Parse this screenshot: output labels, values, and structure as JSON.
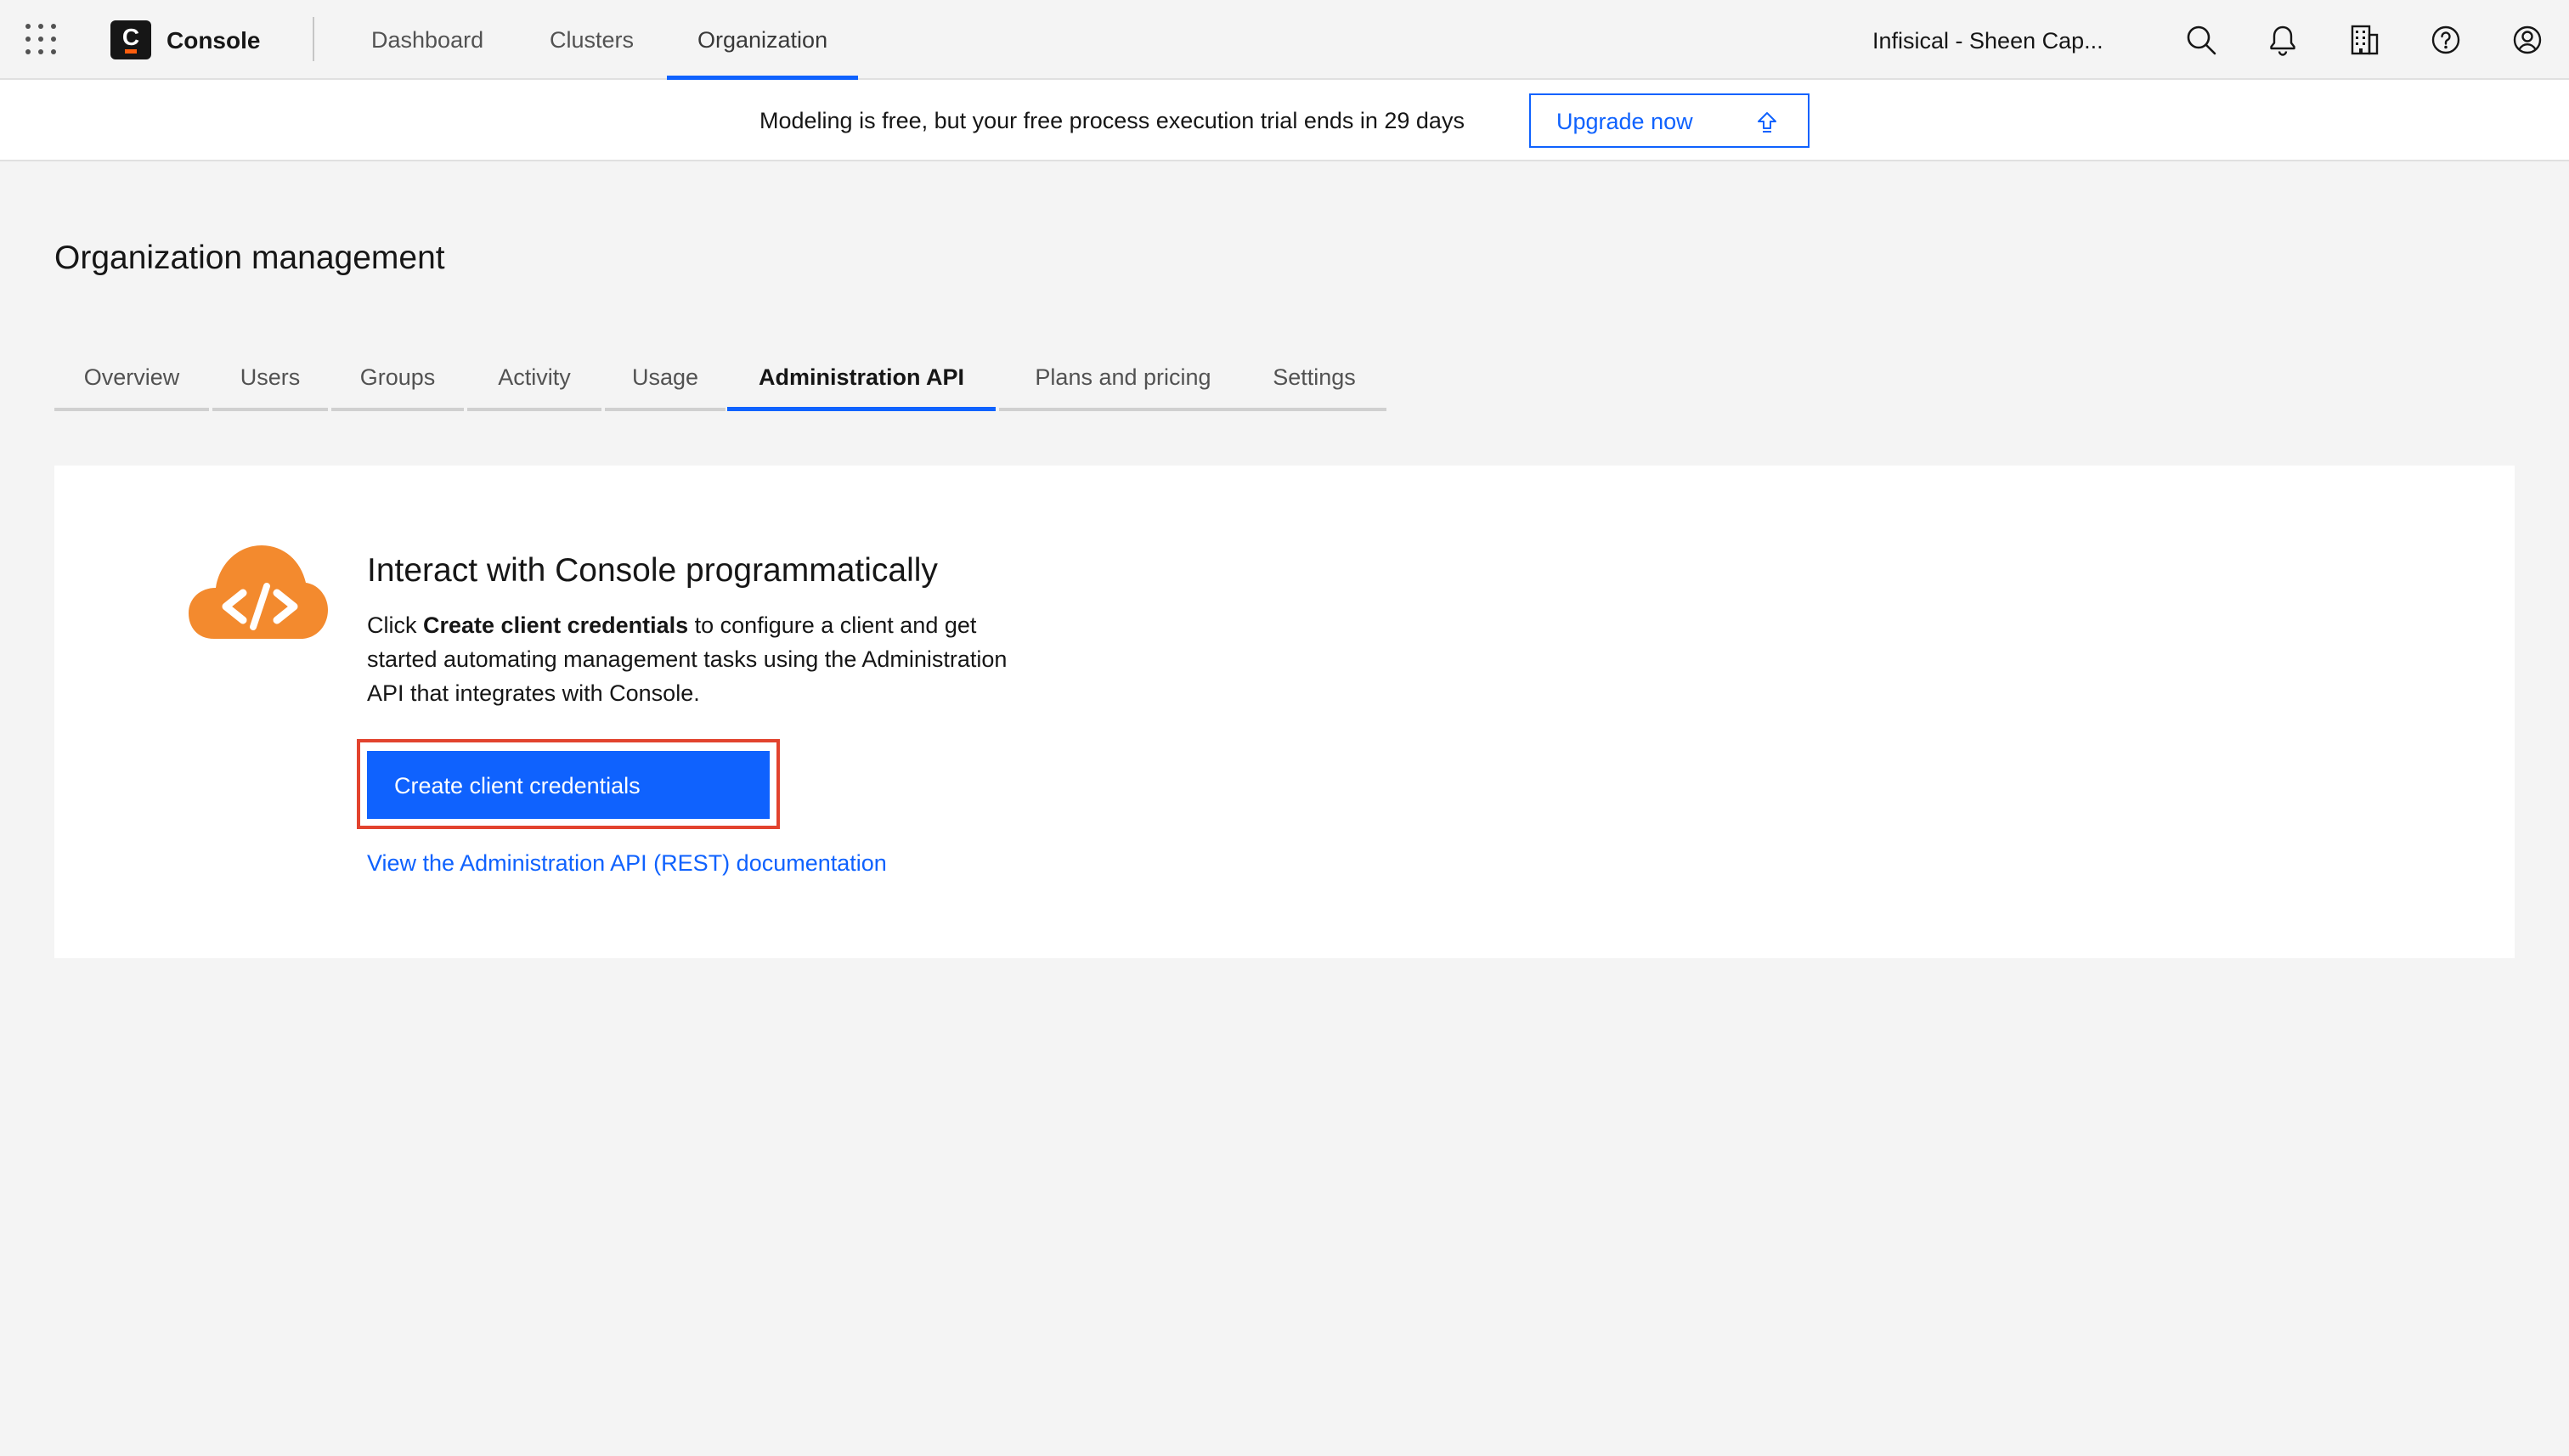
{
  "header": {
    "app_name": "Console",
    "logo_letter": "C",
    "nav": [
      {
        "label": "Dashboard"
      },
      {
        "label": "Clusters"
      },
      {
        "label": "Organization",
        "active": true
      }
    ],
    "org_name": "Infisical - Sheen Cap...",
    "icons": [
      "app-switcher-icon",
      "search-icon",
      "notification-bell-icon",
      "organization-building-icon",
      "help-icon",
      "user-avatar-icon"
    ]
  },
  "banner": {
    "text": "Modeling is free, but your free process execution trial ends in 29 days",
    "upgrade_label": "Upgrade now",
    "upgrade_icon": "upgrade-arrow-icon"
  },
  "page": {
    "title": "Organization management",
    "tabs": [
      {
        "label": "Overview"
      },
      {
        "label": "Users"
      },
      {
        "label": "Groups"
      },
      {
        "label": "Activity"
      },
      {
        "label": "Usage"
      },
      {
        "label": "Administration API",
        "active": true
      },
      {
        "label": "Plans and pricing"
      },
      {
        "label": "Settings"
      }
    ]
  },
  "card": {
    "icon": "cloud-code-icon",
    "heading": "Interact with Console programmatically",
    "desc_prefix": "Click ",
    "desc_bold": "Create client credentials",
    "desc_suffix": " to configure a client and get started automating management tasks using the Administration API that integrates with Console.",
    "primary_button": "Create client credentials",
    "doc_link": "View the Administration API (REST) documentation"
  },
  "colors": {
    "accent": "#0f62fe",
    "highlight": "#e2432e",
    "cloud": "#f38a2e",
    "background": "#f4f4f4"
  }
}
